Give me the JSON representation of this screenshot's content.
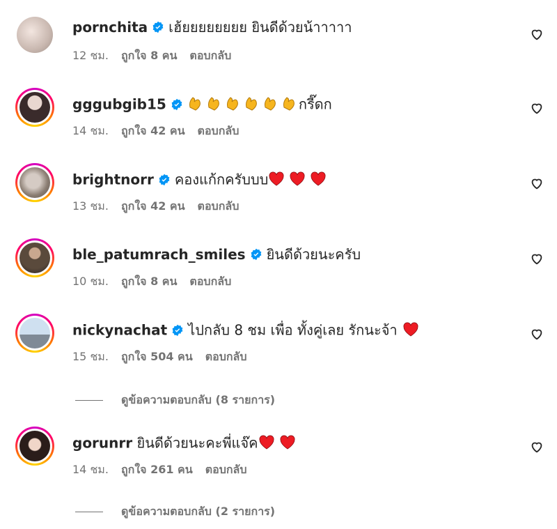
{
  "comments": [
    {
      "username": "pornchita",
      "verified": true,
      "text": "เฮ้ยยยยยยยย ยินดีด้วยน้าาาาา",
      "time": "12 ชม.",
      "likes": "ถูกใจ 8 คน",
      "reply": "ตอบกลับ",
      "avatar_ring": false,
      "avatar_color": "#c9b8b0",
      "emoji": []
    },
    {
      "username": "gggubgib15",
      "verified": true,
      "text": "กรี๊ดก",
      "time": "14 ชม.",
      "likes": "ถูกใจ 42 คน",
      "reply": "ตอบกลับ",
      "avatar_ring": true,
      "avatar_color": "#3a2b2b",
      "emoji": [
        "clap",
        "clap",
        "clap",
        "clap",
        "clap",
        "clap"
      ]
    },
    {
      "username": "brightnorr",
      "verified": true,
      "text": "คองแก้กครับบบ",
      "time": "13 ชม.",
      "likes": "ถูกใจ 42 คน",
      "reply": "ตอบกลับ",
      "avatar_ring": true,
      "avatar_color": "#8a7d72",
      "emoji_after": [
        "heart",
        "heart",
        "heart"
      ]
    },
    {
      "username": "ble_patumrach_smiles",
      "verified": true,
      "text": "ยินดีด้วยนะครับ",
      "time": "10 ชม.",
      "likes": "ถูกใจ 8 คน",
      "reply": "ตอบกลับ",
      "avatar_ring": true,
      "avatar_color": "#5a4a3c",
      "emoji_after": []
    },
    {
      "username": "nickynachat",
      "verified": true,
      "text": "ไปกลับ 8 ชม เพื่อ ทั้งคู่เลย รักนะจ้า",
      "time": "15 ชม.",
      "likes": "ถูกใจ 504 คน",
      "reply": "ตอบกลับ",
      "avatar_ring": true,
      "avatar_color": "#9fb6cf",
      "emoji_after": [
        "heart"
      ]
    },
    {
      "username": "gorunrr",
      "verified": false,
      "text": "ยินดีด้วยนะคะพี่แจ๊ค",
      "time": "14 ชม.",
      "likes": "ถูกใจ 261 คน",
      "reply": "ตอบกลับ",
      "avatar_ring": true,
      "avatar_color": "#caa89a",
      "emoji_after": [
        "heart",
        "heart"
      ]
    }
  ],
  "view_replies": [
    {
      "label": "ดูข้อความตอบกลับ (8 รายการ)"
    },
    {
      "label": "ดูข้อความตอบกลับ (2 รายการ)"
    }
  ],
  "colors": {
    "accent_verified": "#0095f6",
    "heart_red": "#ed1c24",
    "muted": "#737373"
  },
  "icons": {
    "like": "heart-outline-icon",
    "verified": "verified-badge-icon",
    "emoji_clap": "clapping-hands-emoji",
    "emoji_heart": "red-heart-emoji"
  }
}
